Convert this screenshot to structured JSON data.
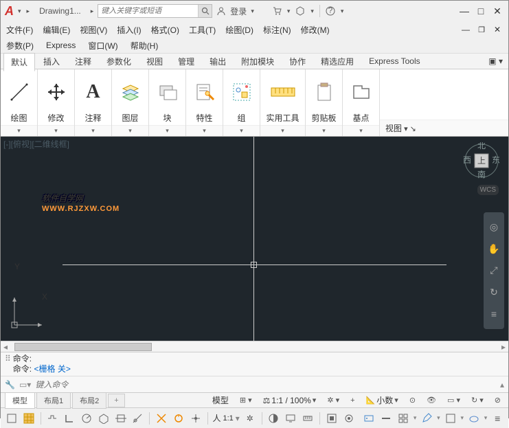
{
  "title": {
    "doc": "Drawing1...",
    "search_placeholder": "键入关键字或短语",
    "login": "登录"
  },
  "menus": {
    "row1": [
      "文件(F)",
      "编辑(E)",
      "视图(V)",
      "插入(I)",
      "格式(O)",
      "工具(T)",
      "绘图(D)",
      "标注(N)",
      "修改(M)"
    ],
    "row2": [
      "参数(P)",
      "Express",
      "窗口(W)",
      "帮助(H)"
    ]
  },
  "ribbon_tabs": [
    "默认",
    "插入",
    "注释",
    "参数化",
    "视图",
    "管理",
    "输出",
    "附加模块",
    "协作",
    "精选应用",
    "Express Tools"
  ],
  "panels": {
    "draw": "绘图",
    "modify": "修改",
    "annot": "注释",
    "layer": "图层",
    "block": "块",
    "props": "特性",
    "group": "组",
    "utility": "实用工具",
    "clipboard": "剪贴板",
    "datum": "基点",
    "view": "视图"
  },
  "canvas": {
    "view_label": "[-][俯视][二维线框]",
    "wcs": "WCS",
    "axis_x": "X",
    "axis_y": "Y",
    "watermark": "软件自学网",
    "watermark_sub": "WWW.RJZXW.COM"
  },
  "cmd": {
    "hist1": "命令:",
    "hist2_pre": "命令:",
    "hist2_val": "<栅格 关>",
    "placeholder": "键入命令"
  },
  "layout_tabs": {
    "model": "模型",
    "l1": "布局1",
    "l2": "布局2",
    "plus": "+"
  },
  "status_right": {
    "model": "模型",
    "scale": "1:1 / 100%",
    "decimal": "小数"
  }
}
